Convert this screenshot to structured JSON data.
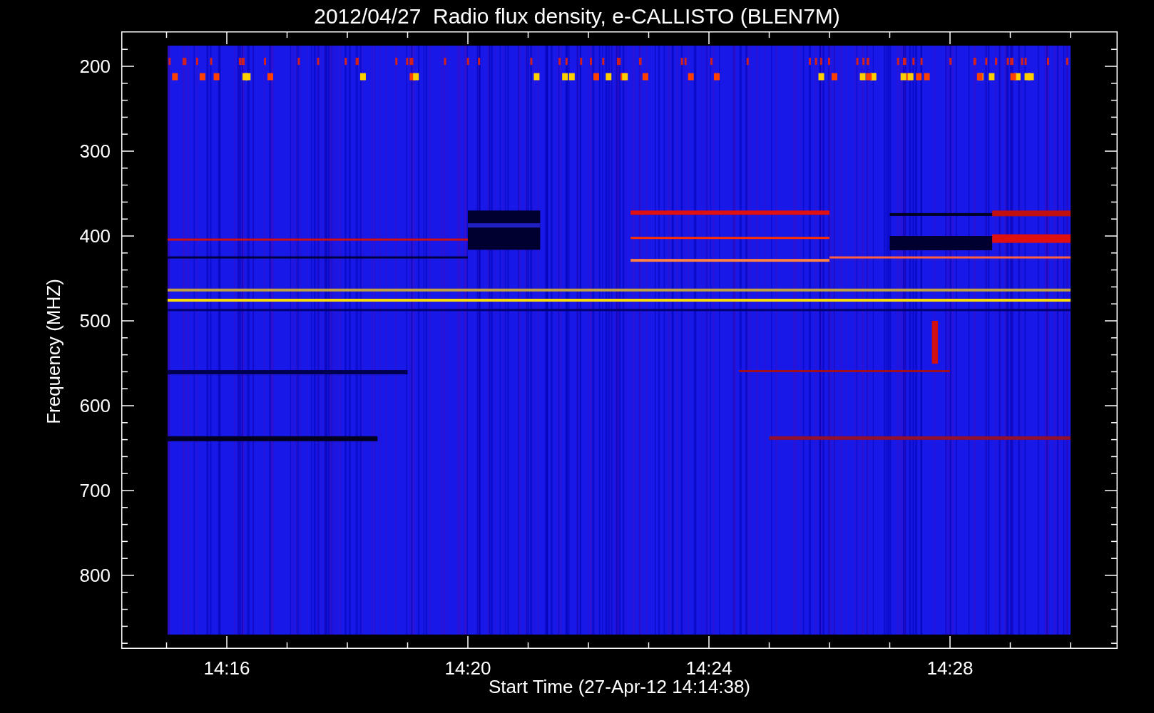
{
  "title": "2012/04/27  Radio flux density, e-CALLISTO (BLEN7M)",
  "y_axis": {
    "label": "Frequency (MHZ)",
    "ticks": [
      "200",
      "300",
      "400",
      "500",
      "600",
      "700",
      "800"
    ]
  },
  "x_axis": {
    "label": "Start Time (27-Apr-12 14:14:38)",
    "ticks": [
      "14:16",
      "14:20",
      "14:24",
      "14:28"
    ]
  }
}
